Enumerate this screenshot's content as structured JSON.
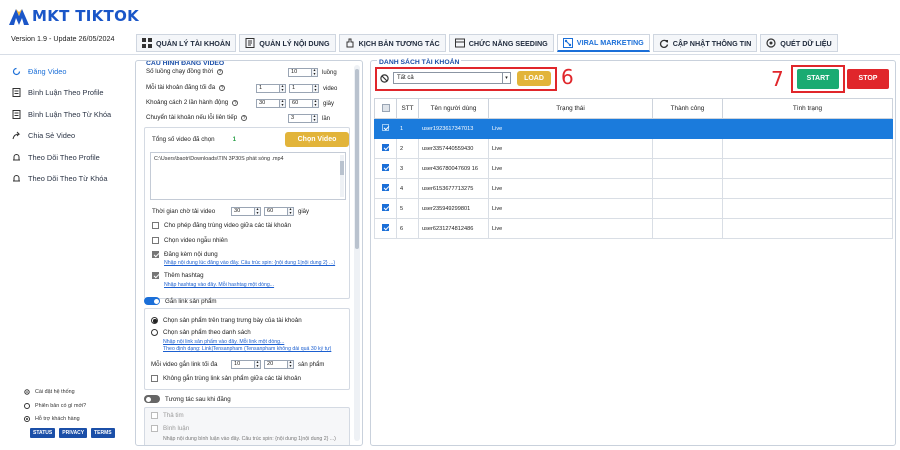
{
  "app": {
    "logo": "MKT TIKTOK",
    "version": "Version  1.9   - Update  26/05/2024",
    "brand_color": "#1b56c8"
  },
  "tabs": [
    {
      "label": "QUẢN LÝ TÀI KHOẢN",
      "icon": "grid-icon"
    },
    {
      "label": "QUẢN LÝ NỘI DUNG",
      "icon": "document-icon"
    },
    {
      "label": "KỊCH BẢN TƯƠNG TÁC",
      "icon": "hand-icon"
    },
    {
      "label": "CHỨC NĂNG SEEDING",
      "icon": "stack-icon"
    },
    {
      "label": "VIRAL MARKETING",
      "icon": "network-icon",
      "active": true
    },
    {
      "label": "CẬP NHẬT THÔNG TIN",
      "icon": "refresh-icon"
    },
    {
      "label": "QUÉT DỮ LIỆU",
      "icon": "scan-icon"
    }
  ],
  "sidebar": {
    "items": [
      {
        "label": "Đăng Video",
        "icon": "video-icon",
        "active": true
      },
      {
        "label": "Bình Luận Theo Profile",
        "icon": "document-icon"
      },
      {
        "label": "Bình Luận Theo Từ Khóa",
        "icon": "document-icon"
      },
      {
        "label": "Chia Sẻ Video",
        "icon": "share-icon"
      },
      {
        "label": "Theo Dõi Theo Profile",
        "icon": "bell-icon"
      },
      {
        "label": "Theo Dõi Theo Từ Khóa",
        "icon": "bell-icon"
      }
    ],
    "bottom": [
      {
        "label": "Cài đặt hệ thống",
        "icon": "gear-icon"
      },
      {
        "label": "Phiên bản có gì mới?",
        "icon": "info-icon"
      },
      {
        "label": "Hỗ trợ khách hàng",
        "icon": "support-icon"
      }
    ],
    "buttons": [
      "STATUS",
      "PRIVACY",
      "TERMS"
    ]
  },
  "config": {
    "title": "CẤU HÌNH ĐĂNG VIDEO",
    "thread_label": "Số luồng chạy đồng thời",
    "thread_value": "10",
    "thread_unit": "luồng",
    "max_label": "Mỗi tài khoản đăng tối đa",
    "max_from": "1",
    "max_to": "1",
    "max_unit": "video",
    "gap_label": "Khoảng cách 2 lần hành động",
    "gap_from": "30",
    "gap_to": "60",
    "gap_unit": "giây",
    "switch_label": "Chuyển tài khoản nếu lỗi liên tiếp",
    "switch_value": "3",
    "switch_unit": "lần",
    "video_count_label": "Tổng số video đã chọn",
    "video_count": "1",
    "choose_video_btn": "Chọn Video",
    "video_path": "C:\\Users\\baotr\\Downloads\\TIN 3P30S phát sóng .mp4",
    "wait_label": "Thời gian chờ tải video",
    "wait_from": "30",
    "wait_to": "60",
    "wait_unit": "giây",
    "opt_allow_dup": "Cho phép đăng trùng video giữa các tài khoản",
    "opt_random": "Chọn video ngẫu nhiên",
    "opt_content": "Đăng kèm nội dung",
    "content_link": "Nhập nội dung lúc đăng vào đây. Câu trúc spin: {nội dung 1|nội dung 2} ...)",
    "opt_hashtag": "Thêm hashtag",
    "hashtag_link": "Nhập hashtag vào đây. Mỗi hashtag một dòng...",
    "product_toggle": "Gắn link sản phẩm",
    "radio_showcase": "Chọn sản phẩm trên trang trưng bày của tài khoản",
    "radio_list": "Chọn sản phẩm theo danh sách",
    "product_link1": "Nhập nội link sản phẩm vào đây. Mỗi link một dòng...",
    "product_link2": "Theo định dạng: Link|Tensanpham (Tensanpham không dài quá 30 ký tự)",
    "per_video_label": "Mỗi video gắn link tối đa",
    "per_video_from": "10",
    "per_video_to": "20",
    "per_video_unit": "sản phẩm",
    "opt_no_dup_link": "Không gắn trùng link sản phẩm giữa các tài khoản",
    "interact_toggle": "Tương tác sau khi đăng",
    "opt_like": "Thả tim",
    "opt_comment": "Bình luận",
    "comment_placeholder": "Nhập nội dung bình luận vào đây. Câu trúc spin: {nội dung 1|nội dung 2} ...)"
  },
  "accounts": {
    "title": "DANH SÁCH TÀI KHOẢN",
    "filter": "Tất cả",
    "load_btn": "LOAD",
    "start_btn": "START",
    "stop_btn": "STOP",
    "annotation_6": "6",
    "annotation_7": "7",
    "columns": [
      "STT",
      "Tên người dùng",
      "Trạng thái",
      "Thành công",
      "Tình trạng"
    ],
    "rows": [
      {
        "stt": "1",
        "user": "user1923617347013",
        "status": "Live",
        "selected": true
      },
      {
        "stt": "2",
        "user": "user3357440559430",
        "status": "Live"
      },
      {
        "stt": "3",
        "user": "user436780047609 16",
        "status": "Live"
      },
      {
        "stt": "4",
        "user": "user6153677713275",
        "status": "Live"
      },
      {
        "stt": "5",
        "user": "user235949299801",
        "status": "Live"
      },
      {
        "stt": "6",
        "user": "user6231274812486",
        "status": "Live"
      }
    ],
    "accent_green": "#1aab72",
    "accent_red": "#e0262b"
  }
}
